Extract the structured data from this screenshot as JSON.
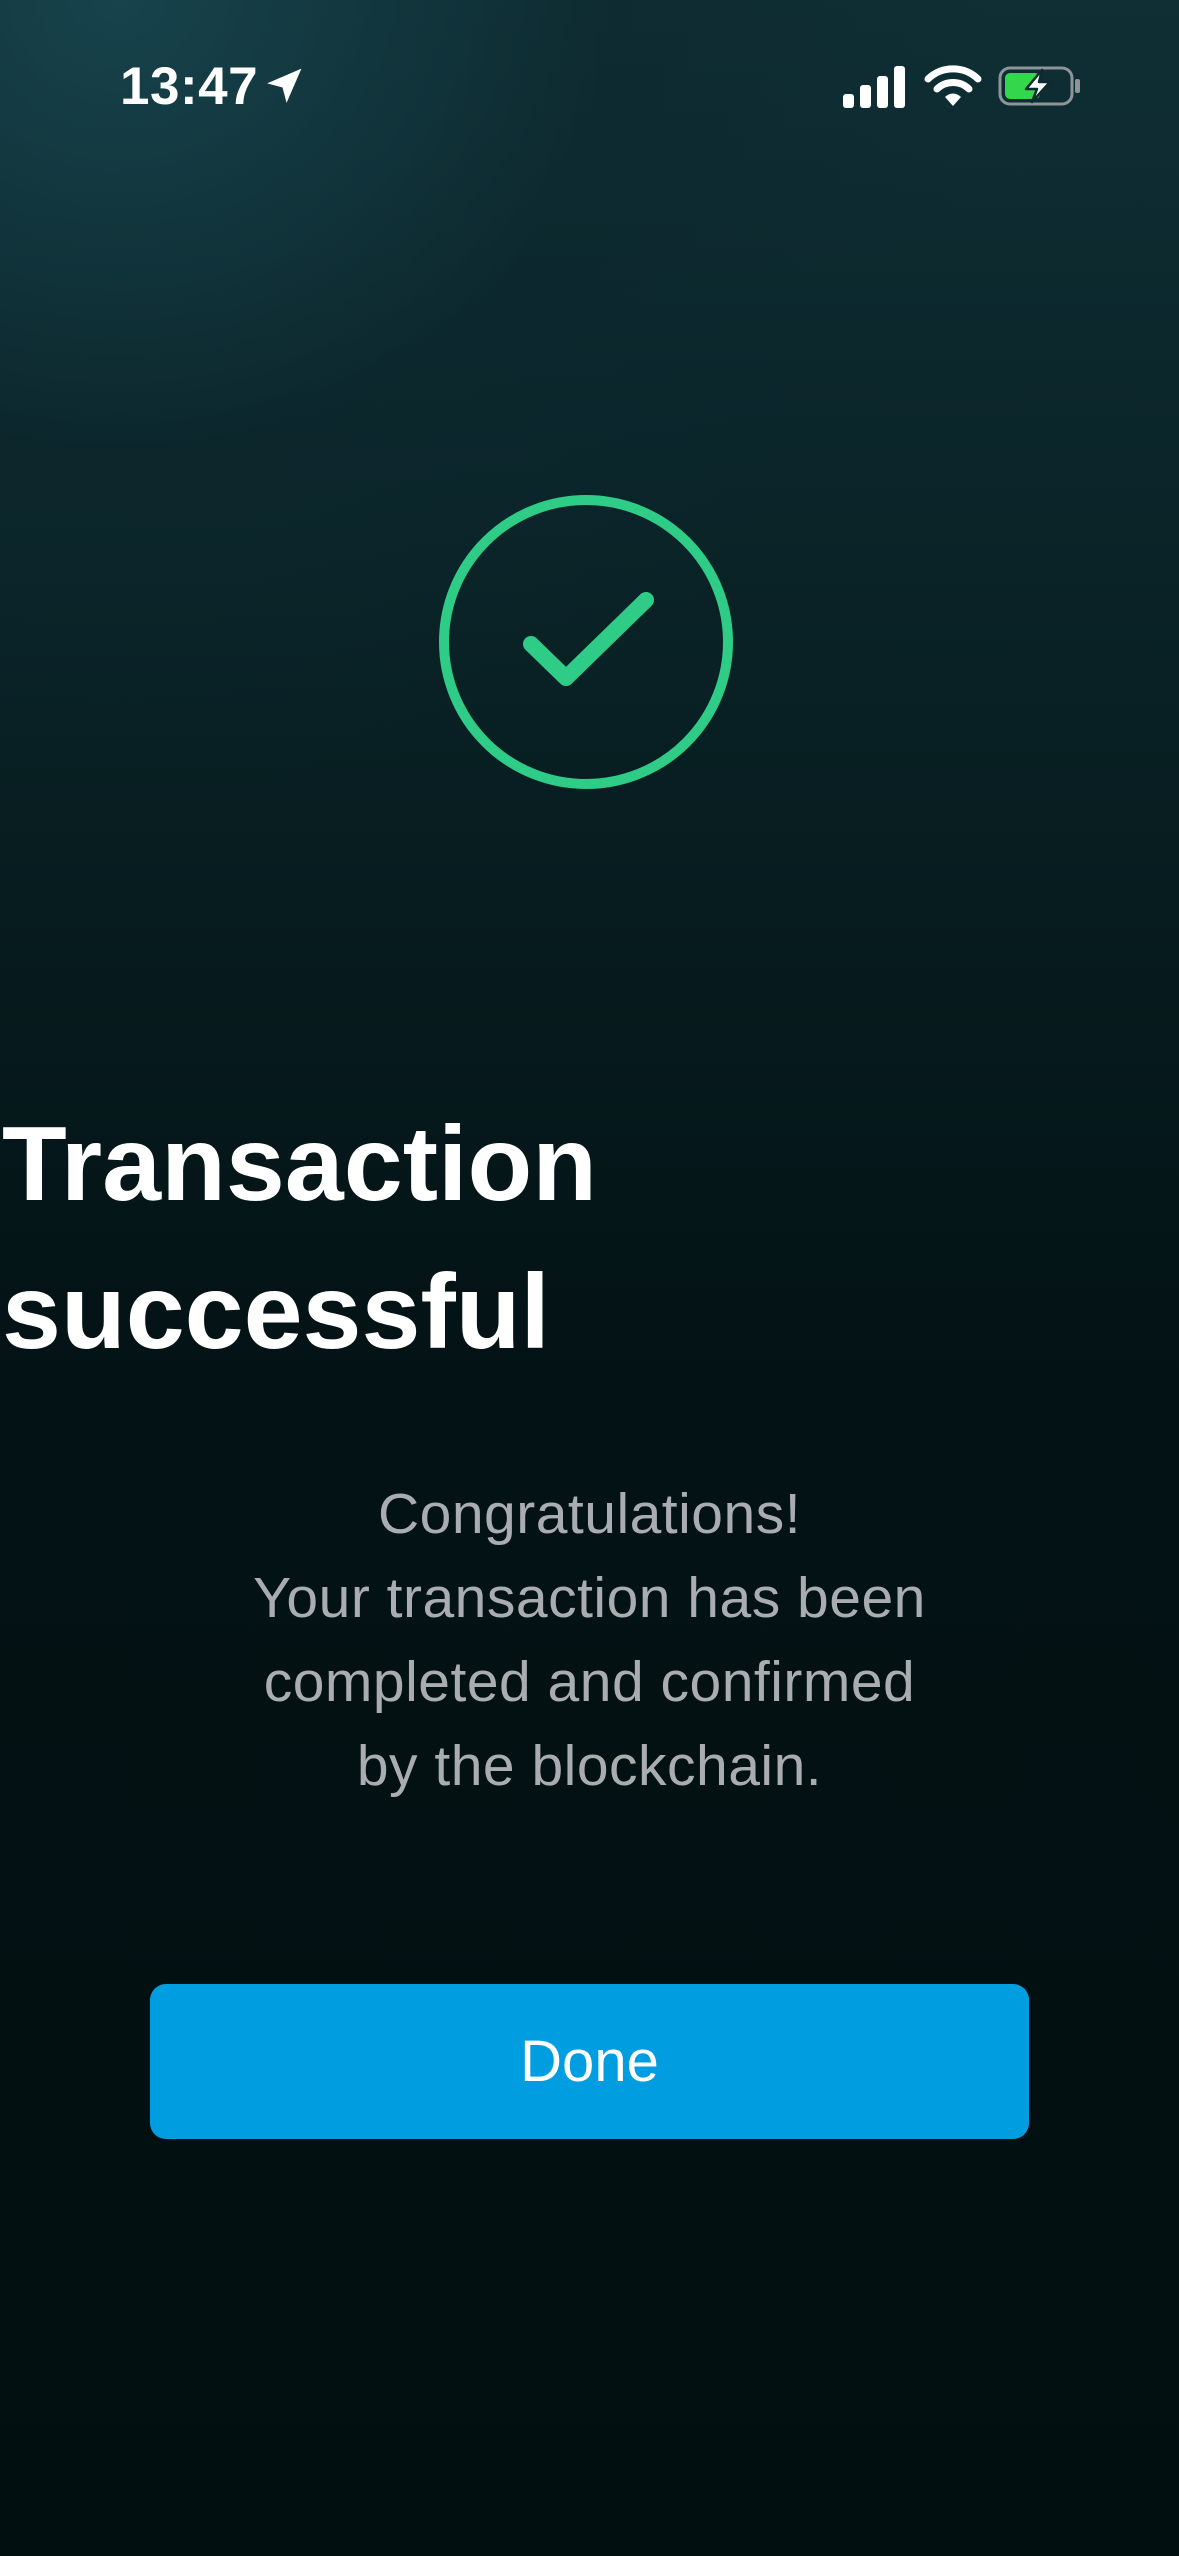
{
  "status_bar": {
    "time": "13:47",
    "icons": {
      "location": "location-arrow-icon",
      "signal": "cellular-signal-icon",
      "wifi": "wifi-icon",
      "battery": "battery-charging-icon"
    },
    "battery_fill_color": "#32d74b"
  },
  "success": {
    "icon": "check-circle-icon",
    "color": "#2ecc87"
  },
  "title": {
    "line1": "Transaction",
    "line2": "successful"
  },
  "message": {
    "line1": "Congratulations!",
    "line2": "Your transaction has been",
    "line3": "completed and confirmed",
    "line4": "by the blockchain."
  },
  "actions": {
    "done_label": "Done",
    "accent_color": "#009ee0"
  }
}
